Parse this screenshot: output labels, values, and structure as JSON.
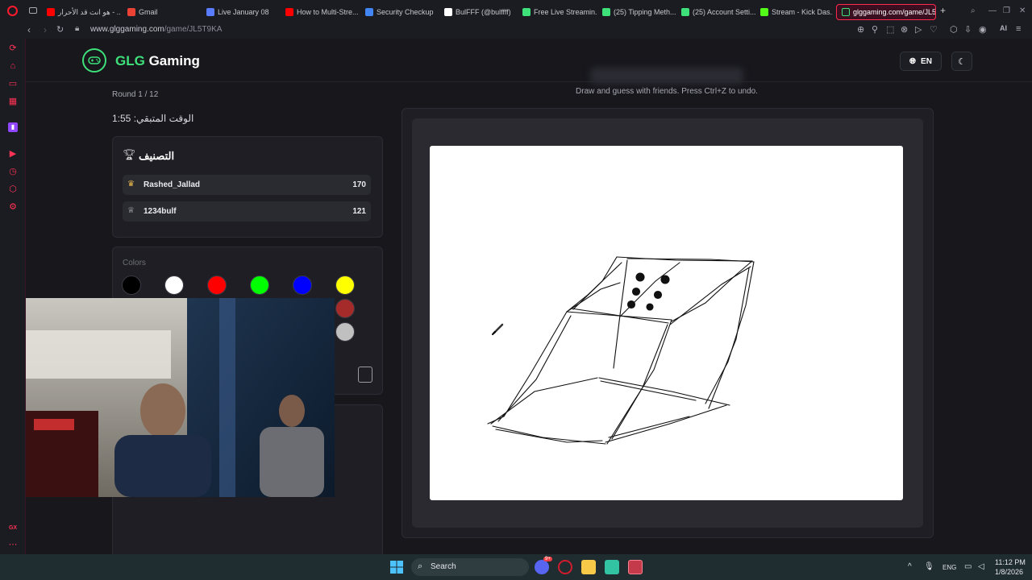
{
  "browser": {
    "tabs": [
      {
        "label": "هو انت قد الأحرار - ...",
        "color": "#ff0000"
      },
      {
        "label": "Gmail",
        "color": "#ea4335"
      },
      {
        "label": "Live January 08",
        "color": "#5a7dff"
      },
      {
        "label": "How to Multi-Stre...",
        "color": "#ff0000"
      },
      {
        "label": "Security Checkup",
        "color": "#4285f4"
      },
      {
        "label": "BulFFF (@bulffff)",
        "color": "#ffffff"
      },
      {
        "label": "Free Live Streamin...",
        "color": "#3ee07a"
      },
      {
        "label": "(25) Tipping Meth...",
        "color": "#3ee07a"
      },
      {
        "label": "(25) Account Setti...",
        "color": "#3ee07a"
      },
      {
        "label": "Stream - Kick Das...",
        "color": "#53fc18"
      }
    ],
    "active_tab": "glggaming.com/game/JL5",
    "new_tab": "+",
    "url_domain": "www.glggaming.com",
    "url_path": "/game/JL5T9KA",
    "ai_label": "AI"
  },
  "site": {
    "brand_prefix": "GLG",
    "brand_suffix": " Gaming",
    "lang": "EN"
  },
  "game": {
    "round": "Round 1 / 12",
    "time_left": "الوقت المتبقي: 1:55",
    "subtitle": "Draw and guess with friends. Press Ctrl+Z to undo."
  },
  "leaderboard": {
    "title": "التصنيف",
    "players": [
      {
        "name": "Rashed_Jallad",
        "score": "170",
        "icon": "crown-icon"
      },
      {
        "name": "1234bulf",
        "score": "121",
        "icon": "trophy-icon"
      }
    ]
  },
  "palette": {
    "label": "Colors",
    "colors": [
      "#000000",
      "#ffffff",
      "#ff0000",
      "#00ff00",
      "#0000ff",
      "#ffff00",
      "#ff00ff",
      "#00ffff",
      "#ffa500",
      "#800080",
      "#ffc0cb",
      "#a52a2a",
      "#808080",
      "#000080",
      "#008000",
      "#800000",
      "#808000",
      "#c0c0c0"
    ]
  },
  "taskbar": {
    "search": "Search",
    "lang": "ENG",
    "time": "11:12 PM",
    "date": "1/8/2026",
    "discord_badge": "9+"
  }
}
